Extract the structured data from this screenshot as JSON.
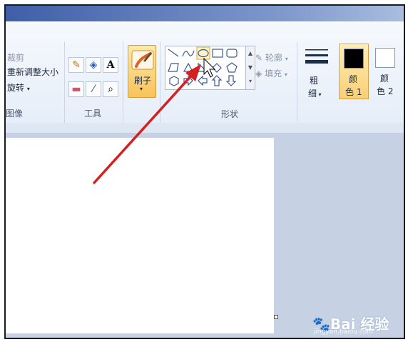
{
  "image_group": {
    "crop": "裁剪",
    "resize": "重新调整大小",
    "rotate": "旋转",
    "label": "图像"
  },
  "tools_group": {
    "label": "工具"
  },
  "brush": {
    "label": "刷子"
  },
  "shapes_group": {
    "outline": "轮廓",
    "fill": "填充",
    "label": "形状"
  },
  "size": {
    "label_line1": "粗",
    "label_line2": "细"
  },
  "color1": {
    "label_line1": "颜",
    "label_line2": "色 1"
  },
  "color2": {
    "label_line1": "颜",
    "label_line2": "色 2"
  },
  "colors": {
    "accent": "#f7c35a",
    "arrow": "#d42020",
    "color1_swatch": "#000000",
    "color2_swatch": "#ffffff"
  },
  "watermark": {
    "brand": "Bai 经验",
    "url": "jingyan.baidu.com"
  }
}
